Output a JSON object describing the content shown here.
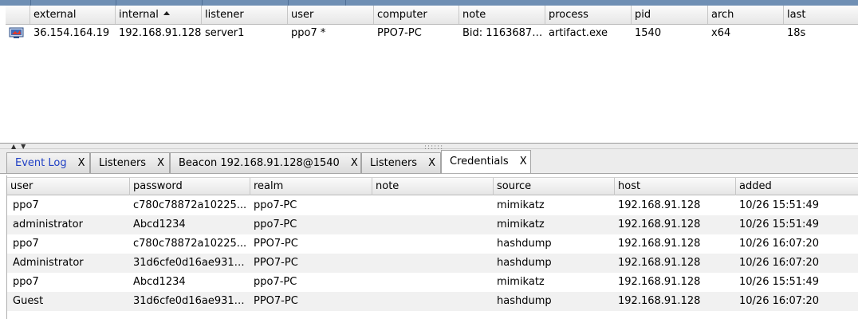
{
  "sessions": {
    "columns": [
      "external",
      "internal",
      "listener",
      "user",
      "computer",
      "note",
      "process",
      "pid",
      "arch",
      "last"
    ],
    "sorted_column": "internal",
    "rows": [
      {
        "icon": "beacon-session-icon",
        "external": "36.154.164.19",
        "internal": "192.168.91.128",
        "listener": "server1",
        "user": "ppo7 *",
        "computer": "PPO7-PC",
        "note": "Bid: 1163687…",
        "process": "artifact.exe",
        "pid": "1540",
        "arch": "x64",
        "last": "18s"
      }
    ]
  },
  "tabs": [
    {
      "label": "Event Log",
      "close": "X",
      "active": false
    },
    {
      "label": "Listeners",
      "close": "X",
      "active": false
    },
    {
      "label": "Beacon 192.168.91.128@1540",
      "close": "X",
      "active": false
    },
    {
      "label": "Listeners",
      "close": "X",
      "active": false
    },
    {
      "label": "Credentials",
      "close": "X",
      "active": true
    }
  ],
  "credentials": {
    "columns": [
      "user",
      "password",
      "realm",
      "note",
      "source",
      "host",
      "added"
    ],
    "rows": [
      {
        "user": "ppo7",
        "password": "c780c78872a10225...",
        "realm": "ppo7-PC",
        "note": "",
        "source": "mimikatz",
        "host": "192.168.91.128",
        "added": "10/26 15:51:49"
      },
      {
        "user": "administrator",
        "password": "Abcd1234",
        "realm": "ppo7-PC",
        "note": "",
        "source": "mimikatz",
        "host": "192.168.91.128",
        "added": "10/26 15:51:49"
      },
      {
        "user": "ppo7",
        "password": "c780c78872a10225...",
        "realm": "PPO7-PC",
        "note": "",
        "source": "hashdump",
        "host": "192.168.91.128",
        "added": "10/26 16:07:20"
      },
      {
        "user": "Administrator",
        "password": "31d6cfe0d16ae931b...",
        "realm": "PPO7-PC",
        "note": "",
        "source": "hashdump",
        "host": "192.168.91.128",
        "added": "10/26 16:07:20"
      },
      {
        "user": "ppo7",
        "password": "Abcd1234",
        "realm": "ppo7-PC",
        "note": "",
        "source": "mimikatz",
        "host": "192.168.91.128",
        "added": "10/26 15:51:49"
      },
      {
        "user": "Guest",
        "password": "31d6cfe0d16ae931b...",
        "realm": "PPO7-PC",
        "note": "",
        "source": "hashdump",
        "host": "192.168.91.128",
        "added": "10/26 16:07:20"
      }
    ]
  },
  "colors": {
    "event_log_tab_text": "#1f3fc4",
    "top_strip": "#6f8fb4",
    "alt_row": "#f1f1f1"
  }
}
